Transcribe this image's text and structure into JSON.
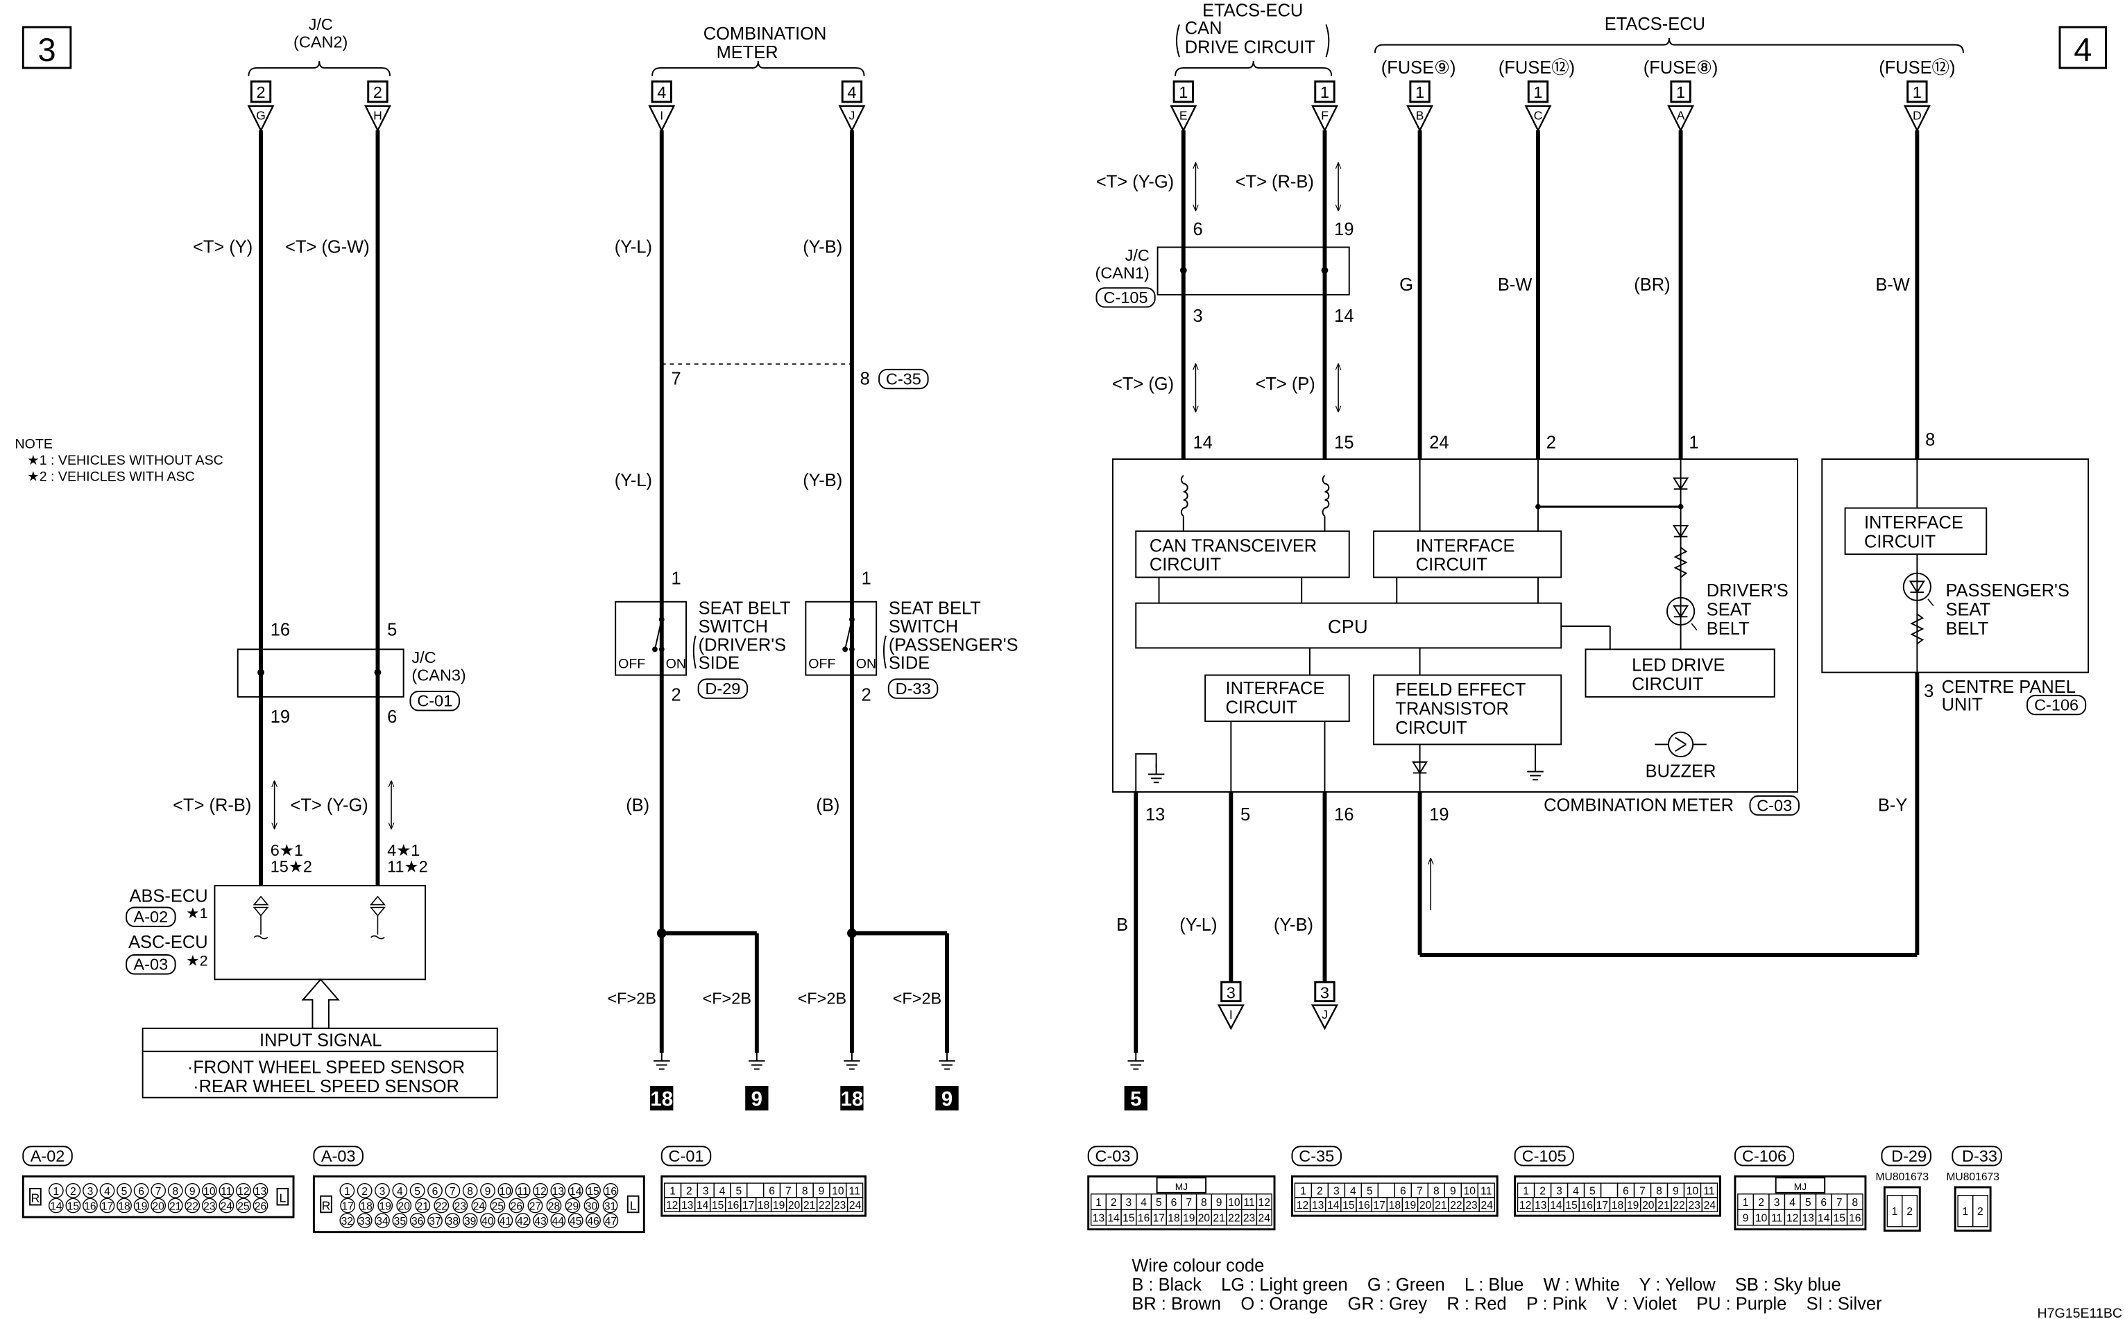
{
  "markers": {
    "left": "3",
    "right": "4"
  },
  "note": {
    "title": "NOTE",
    "n1": "★1 : VEHICLES WITHOUT ASC",
    "n2": "★2 : VEHICLES WITH ASC"
  },
  "heads": [
    {
      "num": "2",
      "letter": "G"
    },
    {
      "num": "2",
      "letter": "H"
    },
    {
      "num": "4",
      "letter": "I"
    },
    {
      "num": "4",
      "letter": "J"
    },
    {
      "num": "1",
      "letter": "E"
    },
    {
      "num": "1",
      "letter": "F"
    },
    {
      "num": "1",
      "letter": "B"
    },
    {
      "num": "1",
      "letter": "C"
    },
    {
      "num": "1",
      "letter": "A"
    },
    {
      "num": "1",
      "letter": "D"
    }
  ],
  "left": {
    "jc_title": "J/C",
    "jc_sub": "(CAN2)",
    "wire1": "<T> (Y)",
    "wire2": "<T> (G-W)",
    "pin16": "16",
    "pin5": "5",
    "jc3_title": "J/C",
    "jc3_sub": "(CAN3)",
    "jc3_conn": "C-01",
    "pin19": "19",
    "pin6": "6",
    "wire3": "<T> (R-B)",
    "wire4": "<T> (Y-G)",
    "pinA1": "6★1",
    "pinA2": "15★2",
    "pinB1": "4★1",
    "pinB2": "11★2",
    "abs": "ABS-ECU",
    "abs_conn": "A-02",
    "abs_star": "★1",
    "asc": "ASC-ECU",
    "asc_conn": "A-03",
    "asc_star": "★2",
    "input_title": "INPUT SIGNAL",
    "input1": "·FRONT WHEEL SPEED SENSOR",
    "input2": "·REAR WHEEL SPEED SENSOR"
  },
  "middle": {
    "title1": "COMBINATION",
    "title2": "METER",
    "w1": "(Y-L)",
    "w2": "(Y-B)",
    "pin7": "7",
    "pin8": "8",
    "c35": "C-35",
    "w3": "(Y-L)",
    "w4": "(Y-B)",
    "pin1a": "1",
    "pin1b": "1",
    "sw1": [
      "SEAT BELT",
      "SWITCH",
      "(DRIVER'S",
      "SIDE"
    ],
    "sw2": [
      "SEAT BELT",
      "SWITCH",
      "(PASSENGER'S",
      "SIDE"
    ],
    "off": "OFF",
    "on": "ON",
    "d29": "D-29",
    "d33": "D-33",
    "pin2a": "2",
    "pin2b": "2",
    "w5": "(B)",
    "w6": "(B)",
    "gnd_wires": [
      "<F>2B",
      "<F>2B",
      "<F>2B",
      "<F>2B"
    ],
    "grounds": [
      "18",
      "9",
      "18",
      "9"
    ]
  },
  "right": {
    "etacs_can": [
      "ETACS-ECU",
      "CAN",
      "DRIVE CIRCUIT"
    ],
    "etacs": "ETACS-ECU",
    "fuses": [
      "(FUSE⑨)",
      "(FUSE⑫)",
      "(FUSE⑧)",
      "(FUSE⑫)"
    ],
    "wire_yg": "<T> (Y-G)",
    "wire_rb": "<T> (R-B)",
    "pin6": "6",
    "pin19": "19",
    "jc1_title": "J/C",
    "jc1_sub": "(CAN1)",
    "jc1_conn": "C-105",
    "pin3": "3",
    "pin14": "14",
    "wire_g2": "<T> (G)",
    "wire_p": "<T> (P)",
    "wc_g": "G",
    "wc_bw": "B-W",
    "wc_br": "(BR)",
    "wc_bw2": "B-W",
    "meter_pins_top": [
      "14",
      "15",
      "24",
      "2",
      "1"
    ],
    "pin8": "8",
    "can_tx": [
      "CAN TRANSCEIVER",
      "CIRCUIT"
    ],
    "iface1": [
      "INTERFACE",
      "CIRCUIT"
    ],
    "cpu": "CPU",
    "driver_belt": [
      "DRIVER'S",
      "SEAT",
      "BELT"
    ],
    "led_drive": [
      "LED DRIVE",
      "CIRCUIT"
    ],
    "iface2": [
      "INTERFACE",
      "CIRCUIT"
    ],
    "fet": [
      "FEELD EFFECT",
      "TRANSISTOR",
      "CIRCUIT"
    ],
    "buzzer": "BUZZER",
    "meter_label": "COMBINATION METER",
    "meter_conn": "C-03",
    "meter_pins_bottom": [
      "13",
      "5",
      "16",
      "19"
    ],
    "iface3": [
      "INTERFACE",
      "CIRCUIT"
    ],
    "pass_belt": [
      "PASSENGER'S",
      "SEAT",
      "BELT"
    ],
    "pin3c": "3",
    "centre": [
      "CENTRE PANEL",
      "UNIT"
    ],
    "centre_conn": "C-106",
    "wc_by": "B-Y",
    "wc_b": "B",
    "wc_yl": "(Y-L)",
    "wc_yb": "(Y-B)",
    "ground": "5",
    "to_heads": [
      {
        "num": "3",
        "letter": "I"
      },
      {
        "num": "3",
        "letter": "J"
      }
    ]
  },
  "connectors": [
    {
      "id": "A-02",
      "shape": "round",
      "sides": [
        "R",
        "L"
      ],
      "rows": [
        [
          "1",
          "2",
          "3",
          "4",
          "5",
          "6",
          "7",
          "8",
          "9",
          "10",
          "11",
          "12",
          "13"
        ],
        [
          "14",
          "15",
          "16",
          "17",
          "18",
          "19",
          "20",
          "21",
          "22",
          "23",
          "24",
          "25",
          "26"
        ]
      ]
    },
    {
      "id": "A-03",
      "shape": "round",
      "sides": [
        "R",
        "L"
      ],
      "rows": [
        [
          "1",
          "2",
          "3",
          "4",
          "5",
          "6",
          "7",
          "8",
          "9",
          "10",
          "11",
          "12",
          "13",
          "14",
          "15",
          "16"
        ],
        [
          "17",
          "18",
          "19",
          "20",
          "21",
          "22",
          "23",
          "24",
          "25",
          "26",
          "27",
          "28",
          "29",
          "30",
          "31"
        ],
        [
          "32",
          "33",
          "34",
          "35",
          "36",
          "37",
          "38",
          "39",
          "40",
          "41",
          "42",
          "43",
          "44",
          "45",
          "46",
          "47"
        ]
      ]
    },
    {
      "id": "C-01",
      "shape": "grid",
      "rows": [
        [
          "1",
          "2",
          "3",
          "4",
          "5",
          "",
          "6",
          "7",
          "8",
          "9",
          "10",
          "11"
        ],
        [
          "12",
          "13",
          "14",
          "15",
          "16",
          "17",
          "18",
          "19",
          "20",
          "21",
          "22",
          "23",
          "24"
        ]
      ]
    },
    {
      "id": "C-03",
      "shape": "grid",
      "mark": "MJ",
      "rows": [
        [
          "1",
          "2",
          "3",
          "4",
          "5",
          "6",
          "7",
          "8",
          "9",
          "10",
          "11",
          "12"
        ],
        [
          "13",
          "14",
          "15",
          "16",
          "17",
          "18",
          "19",
          "20",
          "21",
          "22",
          "23",
          "24"
        ]
      ]
    },
    {
      "id": "C-35",
      "shape": "grid",
      "rows": [
        [
          "1",
          "2",
          "3",
          "4",
          "5",
          "",
          "6",
          "7",
          "8",
          "9",
          "10",
          "11"
        ],
        [
          "12",
          "13",
          "14",
          "15",
          "16",
          "17",
          "18",
          "19",
          "20",
          "21",
          "22",
          "23",
          "24"
        ]
      ]
    },
    {
      "id": "C-105",
      "shape": "grid",
      "rows": [
        [
          "1",
          "2",
          "3",
          "4",
          "5",
          "",
          "6",
          "7",
          "8",
          "9",
          "10",
          "11"
        ],
        [
          "12",
          "13",
          "14",
          "15",
          "16",
          "17",
          "18",
          "19",
          "20",
          "21",
          "22",
          "23",
          "24"
        ]
      ]
    },
    {
      "id": "C-106",
      "shape": "grid",
      "mark": "MJ",
      "rows": [
        [
          "1",
          "2",
          "3",
          "4",
          "5",
          "6",
          "7",
          "8"
        ],
        [
          "9",
          "10",
          "11",
          "12",
          "13",
          "14",
          "15",
          "16"
        ]
      ]
    },
    {
      "id": "D-29",
      "shape": "grid",
      "part": "MU801673",
      "rows": [
        [
          "1",
          "2"
        ]
      ]
    },
    {
      "id": "D-33",
      "shape": "grid",
      "part": "MU801673",
      "rows": [
        [
          "1",
          "2"
        ]
      ]
    }
  ],
  "legend": {
    "title": "Wire colour code",
    "line1": "B : Black    LG : Light green    G : Green    L : Blue    W : White    Y : Yellow    SB : Sky blue",
    "line2": "BR : Brown    O : Orange    GR : Grey    R : Red    P : Pink    V : Violet    PU : Purple    SI : Silver"
  },
  "figure_code": "H7G15E11BC"
}
